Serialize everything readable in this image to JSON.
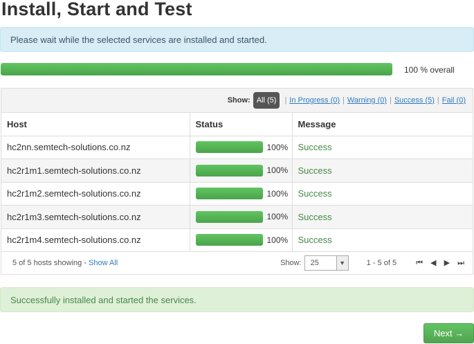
{
  "page": {
    "title": "Install, Start and Test",
    "info_message": "Please wait while the selected services are installed and started.",
    "overall_progress": 100,
    "overall_label": "100 % overall",
    "success_message": "Successfully installed and started the services.",
    "next_label": "Next →"
  },
  "filter": {
    "show_label": "Show:",
    "all": "All (5)",
    "in_progress": "In Progress (0)",
    "warning": "Warning (0)",
    "success": "Success (5)",
    "fail": "Fail (0)"
  },
  "table": {
    "headers": [
      "Host",
      "Status",
      "Message"
    ],
    "rows": [
      {
        "host": "hc2nn.semtech-solutions.co.nz",
        "progress": 100,
        "pct": "100%",
        "message": "Success"
      },
      {
        "host": "hc2r1m1.semtech-solutions.co.nz",
        "progress": 100,
        "pct": "100%",
        "message": "Success"
      },
      {
        "host": "hc2r1m2.semtech-solutions.co.nz",
        "progress": 100,
        "pct": "100%",
        "message": "Success"
      },
      {
        "host": "hc2r1m3.semtech-solutions.co.nz",
        "progress": 100,
        "pct": "100%",
        "message": "Success"
      },
      {
        "host": "hc2r1m4.semtech-solutions.co.nz",
        "progress": 100,
        "pct": "100%",
        "message": "Success"
      }
    ]
  },
  "footer": {
    "showing": "5 of 5 hosts showing -",
    "show_all": "Show All",
    "show_label": "Show:",
    "page_size": "25",
    "range": "1 - 5 of 5",
    "first_icon": "⏮",
    "prev_icon": "◀",
    "next_icon": "▶",
    "last_icon": "⏭"
  },
  "colors": {
    "progress": "#5cb85c",
    "info_bg": "#d9edf7",
    "success_bg": "#dff0d8",
    "link": "#2a7bbd"
  }
}
